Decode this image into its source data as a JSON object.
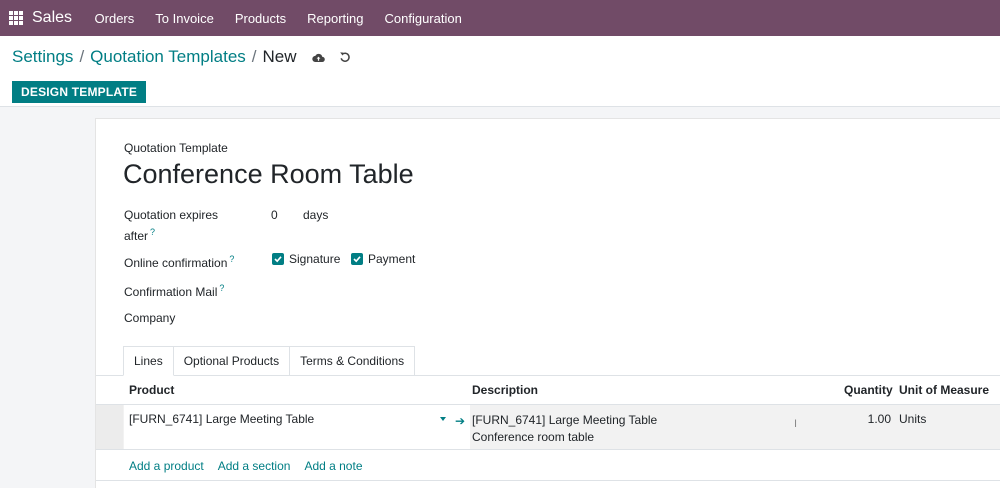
{
  "navbar": {
    "app_name": "Sales",
    "menu": [
      "Orders",
      "To Invoice",
      "Products",
      "Reporting",
      "Configuration"
    ],
    "color": "#714b67"
  },
  "breadcrumb": {
    "items": [
      "Settings",
      "Quotation Templates"
    ],
    "current": "New",
    "icons": [
      "cloud-upload-icon",
      "undo-icon"
    ]
  },
  "actions": {
    "design_template": "DESIGN TEMPLATE"
  },
  "form": {
    "record_label": "Quotation Template",
    "title": "Conference Room Table",
    "expires_label_line1": "Quotation expires",
    "expires_label_line2": "after",
    "expires_value": "0",
    "expires_unit": "days",
    "online_confirmation_label": "Online confirmation",
    "signature_label": "Signature",
    "signature_checked": true,
    "payment_label": "Payment",
    "payment_checked": true,
    "confirmation_mail_label": "Confirmation Mail",
    "company_label": "Company",
    "help_mark": "?"
  },
  "tabs": [
    "Lines",
    "Optional Products",
    "Terms & Conditions"
  ],
  "table": {
    "headers": {
      "product": "Product",
      "description": "Description",
      "quantity": "Quantity",
      "uom": "Unit of Measure"
    },
    "rows": [
      {
        "product": "[FURN_6741] Large Meeting Table",
        "description_line1": "[FURN_6741] Large Meeting Table",
        "description_line2": "Conference room table",
        "quantity": "1.00",
        "uom": "Units"
      }
    ],
    "add_links": [
      "Add a product",
      "Add a section",
      "Add a note"
    ]
  },
  "accent_color": "#017e84"
}
